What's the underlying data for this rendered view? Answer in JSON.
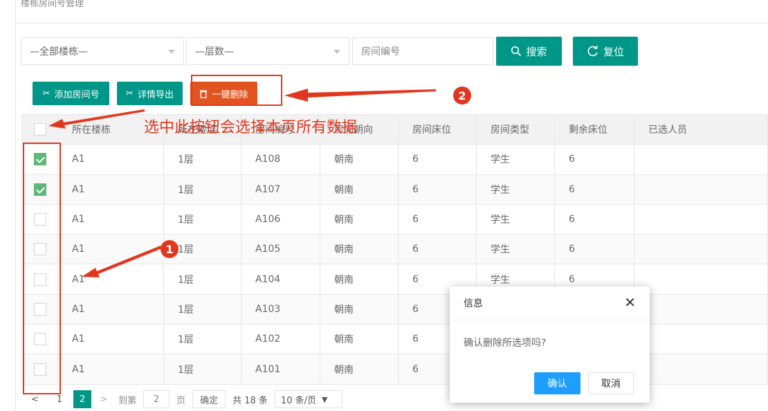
{
  "panel": {
    "title": "楼栋房间号管理"
  },
  "filters": {
    "building": "—全部楼栋—",
    "floor": "—层数—",
    "room_placeholder": "房间编号",
    "search_label": "搜索",
    "reset_label": "复位"
  },
  "toolbar": {
    "add_label": "添加房间号",
    "export_label": "详情导出",
    "delete_label": "一键删除"
  },
  "table": {
    "columns": [
      "所在楼栋",
      "所在楼层",
      "房间编号",
      "房间朝向",
      "房间床位",
      "房间类型",
      "剩余床位",
      "已选人员"
    ],
    "rows": [
      {
        "checked": true,
        "cells": [
          "A1",
          "1层",
          "A108",
          "朝南",
          "6",
          "学生",
          "6",
          ""
        ]
      },
      {
        "checked": true,
        "cells": [
          "A1",
          "1层",
          "A107",
          "朝南",
          "6",
          "学生",
          "6",
          ""
        ]
      },
      {
        "checked": false,
        "cells": [
          "A1",
          "1层",
          "A106",
          "朝南",
          "6",
          "学生",
          "6",
          ""
        ]
      },
      {
        "checked": false,
        "cells": [
          "A1",
          "1层",
          "A105",
          "朝南",
          "6",
          "学生",
          "6",
          ""
        ]
      },
      {
        "checked": false,
        "cells": [
          "A1",
          "1层",
          "A104",
          "朝南",
          "6",
          "学生",
          "6",
          ""
        ]
      },
      {
        "checked": false,
        "cells": [
          "A1",
          "1层",
          "A103",
          "朝南",
          "6",
          "",
          "",
          ""
        ]
      },
      {
        "checked": false,
        "cells": [
          "A1",
          "1层",
          "A102",
          "朝南",
          "6",
          "",
          "",
          ""
        ]
      },
      {
        "checked": false,
        "cells": [
          "A1",
          "1层",
          "A101",
          "朝南",
          "6",
          "",
          "",
          ""
        ]
      }
    ]
  },
  "pager": {
    "prev": "<",
    "page1": "1",
    "current": "2",
    "next": ">",
    "goto_label": "到第",
    "goto_value": "2",
    "page_suffix": "页",
    "confirm_label": "确定",
    "total": "共 18 条",
    "per_page": "10 条/页"
  },
  "dialog": {
    "title": "信息",
    "close": "✕",
    "message": "确认删除所选项吗?",
    "confirm_label": "确认",
    "cancel_label": "取消"
  },
  "annotations": {
    "note": "选中此按钮会选择本页所有数据",
    "badge1": "1",
    "badge2": "2"
  },
  "colors": {
    "teal": "#009688",
    "delete_orange": "#e2541f",
    "dialog_blue": "#1e9fff",
    "checkbox_green": "#5fb878",
    "annotation_red": "#e2371f"
  },
  "icons": {
    "search": "magnifier-icon",
    "reset": "refresh-icon",
    "add": "tools-icon",
    "export": "tools-icon",
    "delete": "trash-icon"
  }
}
